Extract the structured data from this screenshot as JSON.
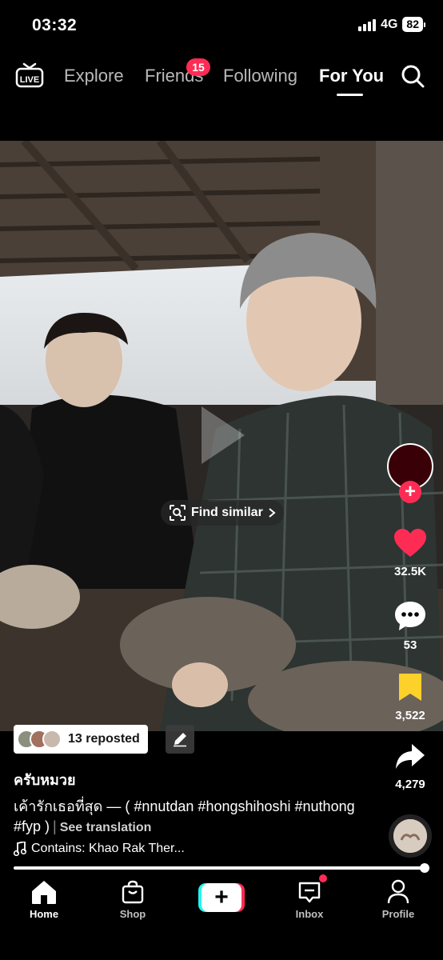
{
  "status_bar": {
    "time": "03:32",
    "network": "4G",
    "battery": "82"
  },
  "top_nav": {
    "live_label": "LIVE",
    "tabs": [
      {
        "label": "Explore",
        "active": false
      },
      {
        "label": "Friends",
        "active": false,
        "badge": "15"
      },
      {
        "label": "Following",
        "active": false
      },
      {
        "label": "For You",
        "active": true
      }
    ]
  },
  "video": {
    "find_similar": "Find similar"
  },
  "actions": {
    "likes": "32.5K",
    "comments": "53",
    "saves": "3,522",
    "shares": "4,279"
  },
  "post": {
    "reposted": "13 reposted",
    "username": "ครับหมวย",
    "caption": "เค้ารักเธอที่สุด — ( #nnutdan #hongshihoshi #nuthong #fyp )",
    "see_translation": "See translation",
    "music": "Contains: Khao Rak Ther..."
  },
  "bottom_nav": {
    "items": [
      {
        "label": "Home",
        "active": true
      },
      {
        "label": "Shop",
        "active": false
      },
      {
        "label": "Inbox",
        "active": false
      },
      {
        "label": "Profile",
        "active": false
      }
    ]
  },
  "colors": {
    "accent": "#fe2c55",
    "create_cyan": "#25f4ee",
    "save_yellow": "#fcd12a"
  }
}
